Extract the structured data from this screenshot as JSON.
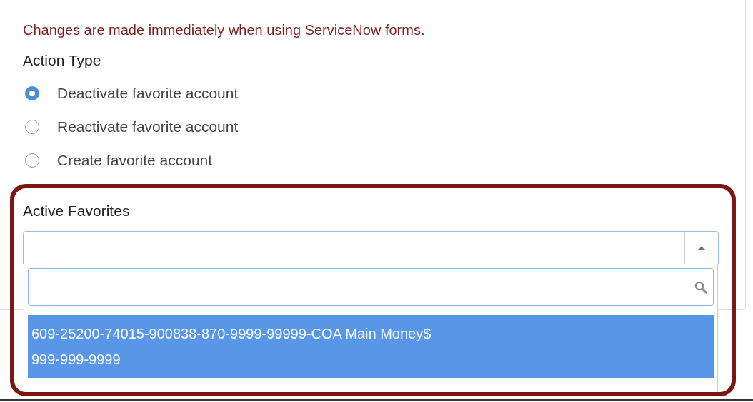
{
  "notice": "Changes are made immediately when using ServiceNow forms.",
  "action_type": {
    "label": "Action Type",
    "options": [
      {
        "label": "Deactivate favorite account",
        "selected": true
      },
      {
        "label": "Reactivate favorite account",
        "selected": false
      },
      {
        "label": "Create favorite account",
        "selected": false
      }
    ]
  },
  "active_favorites": {
    "label": "Active Favorites",
    "expanded": true,
    "options": [
      {
        "label": "609-25200-74015-900838-870-9999-99999-COA Main Money$\n999-999-9999",
        "selected": true
      }
    ]
  }
}
